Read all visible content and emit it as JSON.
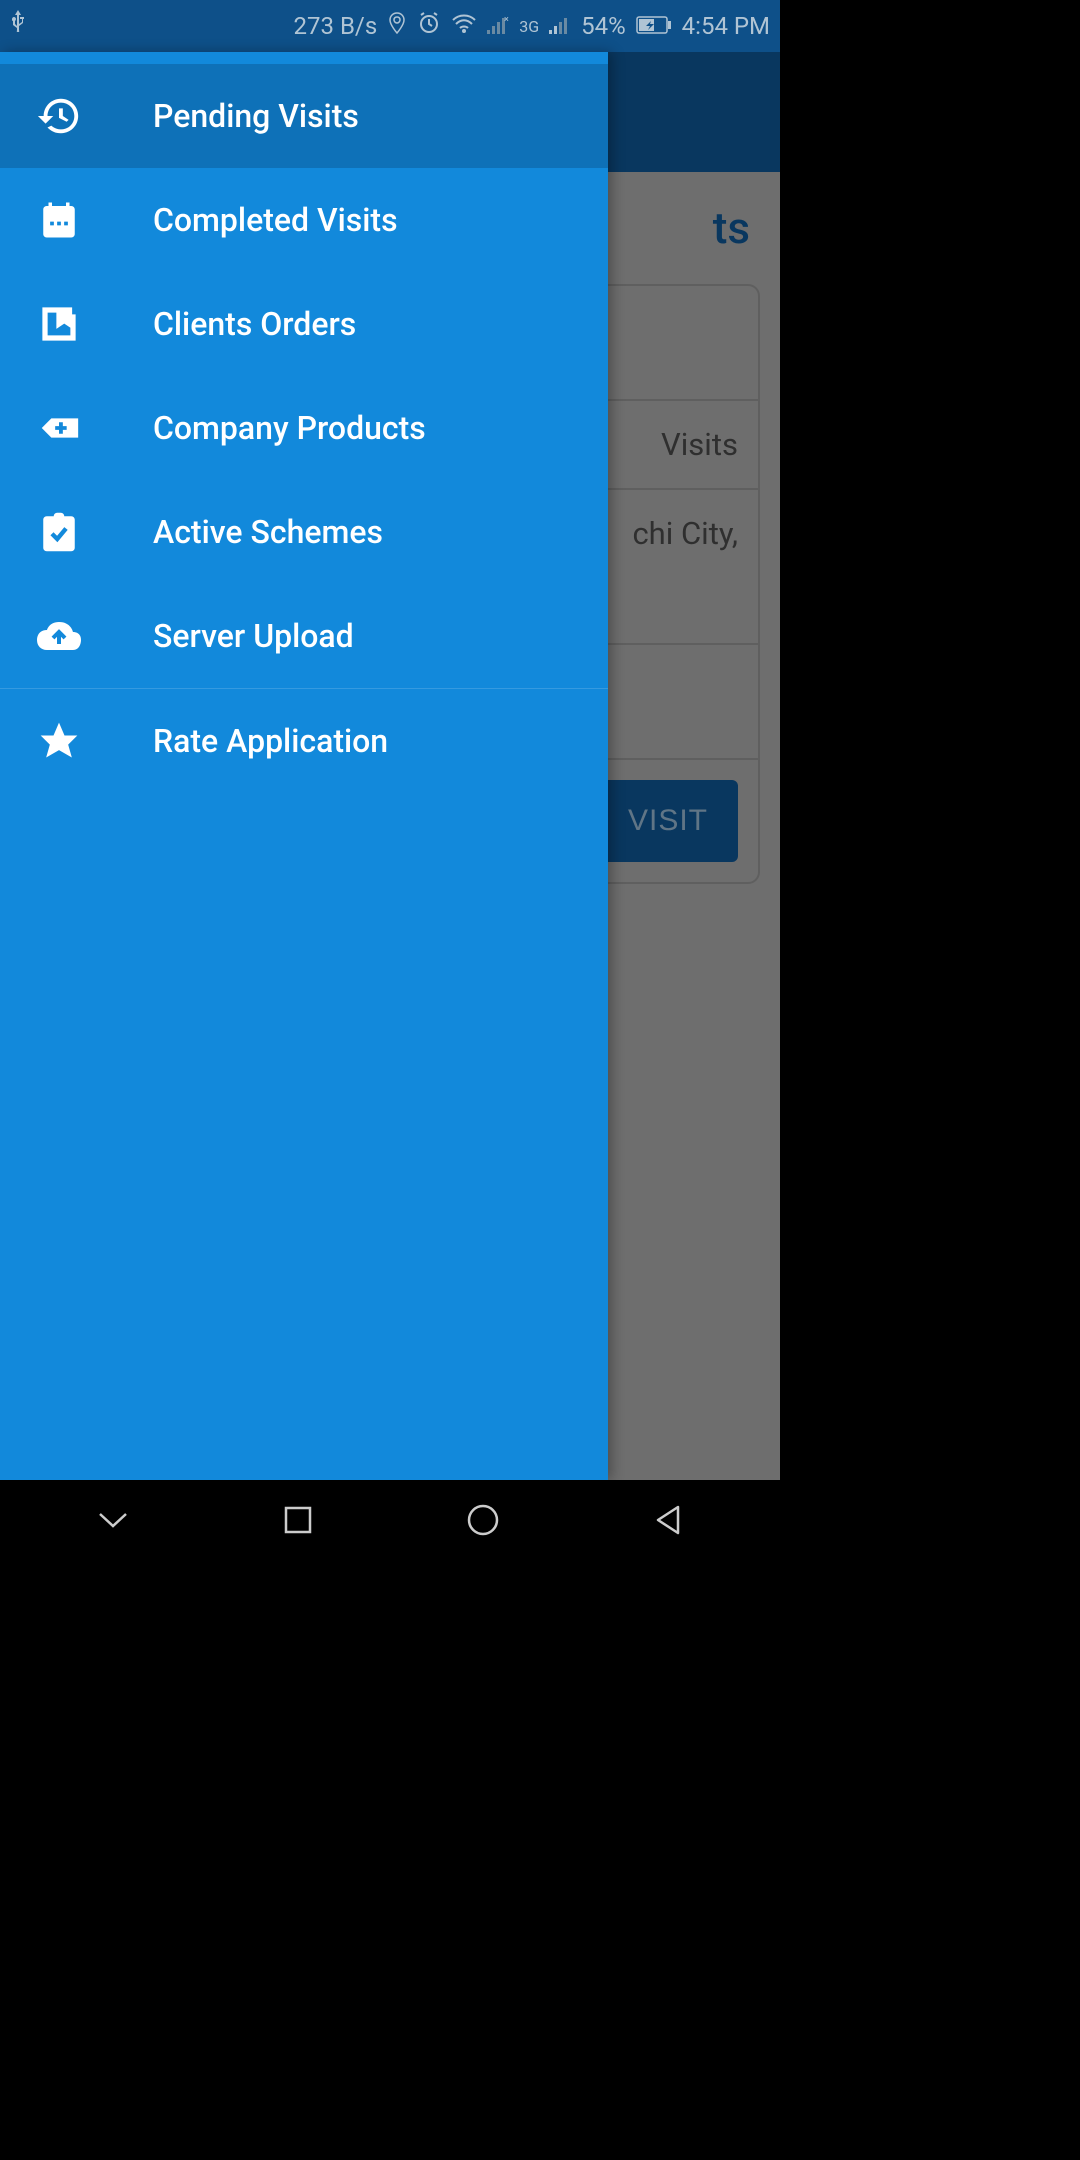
{
  "status": {
    "speed": "273 B/s",
    "battery_pct": "54%",
    "time": "4:54 PM",
    "network_label": "3G"
  },
  "main": {
    "title_partial": "ts",
    "card_visits_partial": "Visits",
    "card_city_partial": "chi City,",
    "button_label": "VISIT"
  },
  "drawer": {
    "items": [
      {
        "label": "Pending Visits"
      },
      {
        "label": "Completed Visits"
      },
      {
        "label": "Clients Orders"
      },
      {
        "label": "Company Products"
      },
      {
        "label": "Active Schemes"
      },
      {
        "label": "Server Upload"
      },
      {
        "label": "Rate Application"
      }
    ]
  }
}
